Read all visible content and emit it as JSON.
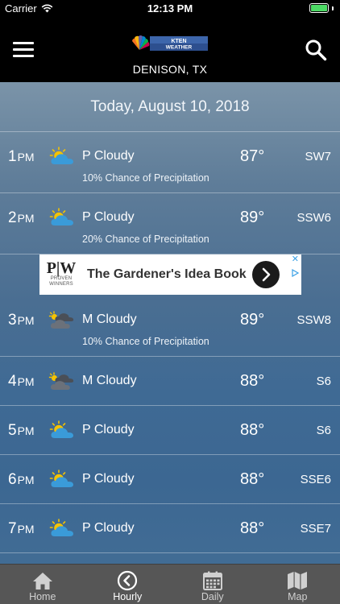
{
  "status_bar": {
    "carrier": "Carrier",
    "time": "12:13 PM"
  },
  "header": {
    "location": "DENISON, TX",
    "logo_text_line1": "KTEN",
    "logo_text_line2": "WEATHER"
  },
  "date_banner": "Today, August 10, 2018",
  "hourly": [
    {
      "hour": "1",
      "ampm": "PM",
      "icon": "partly-cloudy-icon",
      "condition": "P Cloudy",
      "temp": "87°",
      "wind": "SW7",
      "precip": "10% Chance of Precipitation"
    },
    {
      "hour": "2",
      "ampm": "PM",
      "icon": "partly-cloudy-icon",
      "condition": "P Cloudy",
      "temp": "89°",
      "wind": "SSW6",
      "precip": "20% Chance of Precipitation"
    },
    {
      "hour": "3",
      "ampm": "PM",
      "icon": "mostly-cloudy-icon",
      "condition": "M Cloudy",
      "temp": "89°",
      "wind": "SSW8",
      "precip": "10% Chance of Precipitation"
    },
    {
      "hour": "4",
      "ampm": "PM",
      "icon": "mostly-cloudy-icon",
      "condition": "M Cloudy",
      "temp": "88°",
      "wind": "S6"
    },
    {
      "hour": "5",
      "ampm": "PM",
      "icon": "partly-cloudy-icon",
      "condition": "P Cloudy",
      "temp": "88°",
      "wind": "S6"
    },
    {
      "hour": "6",
      "ampm": "PM",
      "icon": "partly-cloudy-icon",
      "condition": "P Cloudy",
      "temp": "88°",
      "wind": "SSE6"
    },
    {
      "hour": "7",
      "ampm": "PM",
      "icon": "partly-cloudy-icon",
      "condition": "P Cloudy",
      "temp": "88°",
      "wind": "SSE7"
    }
  ],
  "ad": {
    "brand_logo": "P|W",
    "brand_sub_1": "PROVEN",
    "brand_sub_2": "WINNERS",
    "title": "The Gardener's Idea Book"
  },
  "tabs": [
    {
      "label": "Home",
      "icon": "home-icon",
      "active": false
    },
    {
      "label": "Hourly",
      "icon": "clock-back-icon",
      "active": true
    },
    {
      "label": "Daily",
      "icon": "calendar-icon",
      "active": false
    },
    {
      "label": "Map",
      "icon": "map-icon",
      "active": false
    }
  ],
  "colors": {
    "header_bg": "#000000",
    "tabbar_bg": "#565656",
    "battery": "#4cd964",
    "sun": "#f5c300",
    "cloud": "#3a9bd9"
  }
}
